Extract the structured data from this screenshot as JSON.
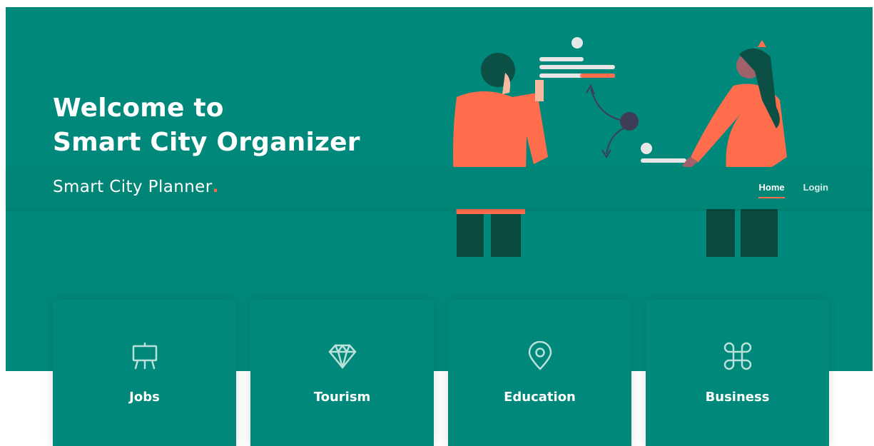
{
  "colors": {
    "primary": "#00897b",
    "navbar": "#008577",
    "accent": "#ff6d4d",
    "text": "#ffffff"
  },
  "hero": {
    "title_line1": "Welcome to",
    "title_line2": "Smart City Organizer"
  },
  "navbar": {
    "brand": "Smart City Planner",
    "brand_dot": ".",
    "links": [
      {
        "label": "Home",
        "active": true
      },
      {
        "label": "Login",
        "active": false
      }
    ]
  },
  "cards": [
    {
      "label": "Jobs",
      "icon": "presentation-easel-icon"
    },
    {
      "label": "Tourism",
      "icon": "diamond-icon"
    },
    {
      "label": "Education",
      "icon": "map-pin-icon"
    },
    {
      "label": "Business",
      "icon": "command-key-icon"
    }
  ]
}
